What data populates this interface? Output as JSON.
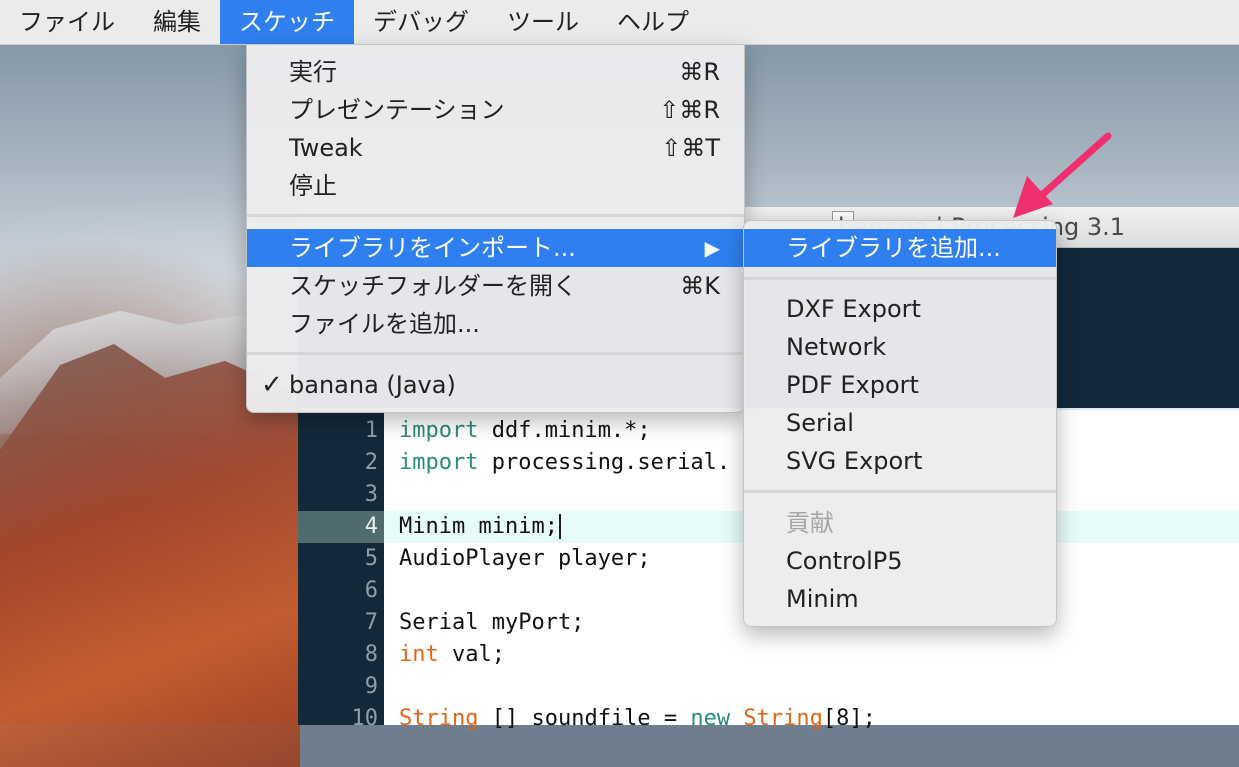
{
  "menubar": {
    "items": [
      "ファイル",
      "編集",
      "スケッチ",
      "デバッグ",
      "ツール",
      "ヘルプ"
    ],
    "active_index": 2
  },
  "sketch_menu": {
    "items": [
      {
        "label": "実行",
        "shortcut": "⌘R"
      },
      {
        "label": "プレゼンテーション",
        "shortcut": "⇧⌘R"
      },
      {
        "label": "Tweak",
        "shortcut": "⇧⌘T"
      },
      {
        "label": "停止",
        "shortcut": ""
      },
      {
        "label": "ライブラリをインポート...",
        "shortcut": "▶",
        "highlighted": true
      },
      {
        "label": "スケッチフォルダーを開く",
        "shortcut": "⌘K"
      },
      {
        "label": "ファイルを追加...",
        "shortcut": ""
      },
      {
        "label": "banana (Java)",
        "checked": true,
        "check_glyph": "✓"
      }
    ]
  },
  "library_submenu": {
    "add_library": "ライブラリを追加...",
    "libraries": [
      "DXF Export",
      "Network",
      "PDF Export",
      "Serial",
      "SVG Export"
    ],
    "contrib_header": "貢献",
    "contrib": [
      "ControlP5",
      "Minim"
    ]
  },
  "window": {
    "title": "banana | Processing 3.1"
  },
  "code": {
    "lines": [
      {
        "n": "1",
        "text": "import ddf.minim.*;"
      },
      {
        "n": "2",
        "text": "import processing.serial."
      },
      {
        "n": "3",
        "text": ""
      },
      {
        "n": "4",
        "text": "Minim minim;"
      },
      {
        "n": "5",
        "text": "AudioPlayer player;"
      },
      {
        "n": "6",
        "text": ""
      },
      {
        "n": "7",
        "text": "Serial myPort;"
      },
      {
        "n": "8",
        "text": "int val;"
      },
      {
        "n": "9",
        "text": ""
      },
      {
        "n": "10",
        "text": "String [] soundfile = new String[8];"
      }
    ],
    "current_line": 4
  },
  "colors": {
    "accent": "#2f7ff0",
    "annotation_arrow": "#f0306e",
    "keyword": "#2a8c7c",
    "type_keyword": "#e2661a"
  }
}
